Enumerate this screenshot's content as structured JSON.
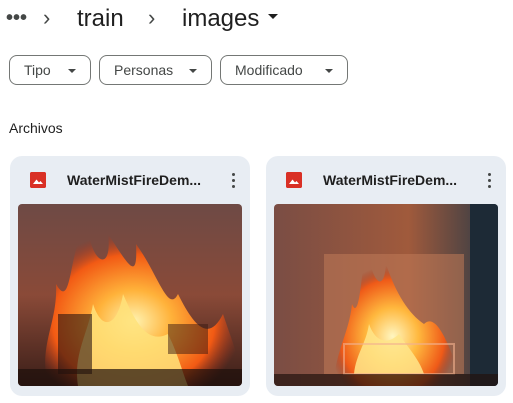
{
  "breadcrumb": {
    "more": "•••",
    "separator": "›",
    "items": [
      "train",
      "images"
    ]
  },
  "filters": [
    {
      "label": "Tipo"
    },
    {
      "label": "Personas"
    },
    {
      "label": "Modificado"
    }
  ],
  "section": {
    "title": "Archivos"
  },
  "files": [
    {
      "name": "WaterMistFireDem...",
      "icon": "image-file-icon"
    },
    {
      "name": "WaterMistFireDem...",
      "icon": "image-file-icon"
    }
  ],
  "colors": {
    "card_bg": "#e8edf3",
    "icon_red": "#d93025",
    "chip_border": "#747775"
  }
}
